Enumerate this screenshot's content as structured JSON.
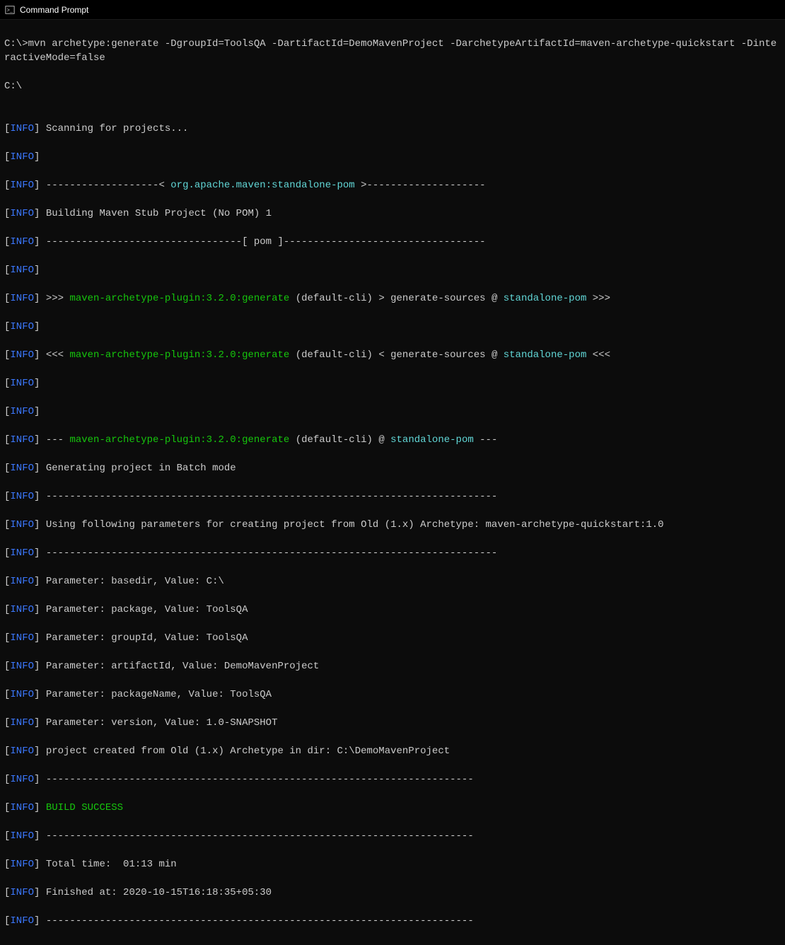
{
  "window": {
    "title": "Command Prompt"
  },
  "prompt1": "C:\\>mvn archetype:generate -DgroupId=ToolsQA -DartifactId=DemoMavenProject -DarchetypeArtifactId=maven-archetype-quickstart -DinteractiveMode=false",
  "prompt2": "C:\\",
  "tag": "INFO",
  "lb": "[",
  "rb": "] ",
  "rbOnly": "]",
  "l": {
    "scan": "Scanning for projects...",
    "sep1a": "-------------------< ",
    "sep1b": "org.apache.maven:standalone-pom",
    "sep1c": " >--------------------",
    "build": "Building Maven Stub Project (No POM) 1",
    "pomline": "---------------------------------[ pom ]----------------------------------",
    "r1a": ">>> ",
    "r1b": "maven-archetype-plugin:3.2.0:generate",
    "r1c": " (default-cli) > generate-sources @ ",
    "r1d": "standalone-pom",
    "r1e": " >>>",
    "r2a": "<<< ",
    "r2b": "maven-archetype-plugin:3.2.0:generate",
    "r2c": " (default-cli) < generate-sources @ ",
    "r2d": "standalone-pom",
    "r2e": " <<<",
    "r3a": "--- ",
    "r3b": "maven-archetype-plugin:3.2.0:generate",
    "r3c": " (default-cli) @ ",
    "r3d": "standalone-pom",
    "r3e": " ---",
    "gen": "Generating project in Batch mode",
    "dash": "----------------------------------------------------------------------------",
    "using": "Using following parameters for creating project from Old (1.x) Archetype: maven-archetype-quickstart:1.0",
    "p1": "Parameter: basedir, Value: C:\\",
    "p2": "Parameter: package, Value: ToolsQA",
    "p3": "Parameter: groupId, Value: ToolsQA",
    "p4": "Parameter: artifactId, Value: DemoMavenProject",
    "p5": "Parameter: packageName, Value: ToolsQA",
    "p6": "Parameter: version, Value: 1.0-SNAPSHOT",
    "created": "project created from Old (1.x) Archetype in dir: C:\\DemoMavenProject",
    "dash2": "------------------------------------------------------------------------",
    "success": "BUILD SUCCESS",
    "total": "Total time:  01:13 min",
    "finished": "Finished at: 2020-10-15T16:18:35+05:30"
  },
  "blank": ""
}
